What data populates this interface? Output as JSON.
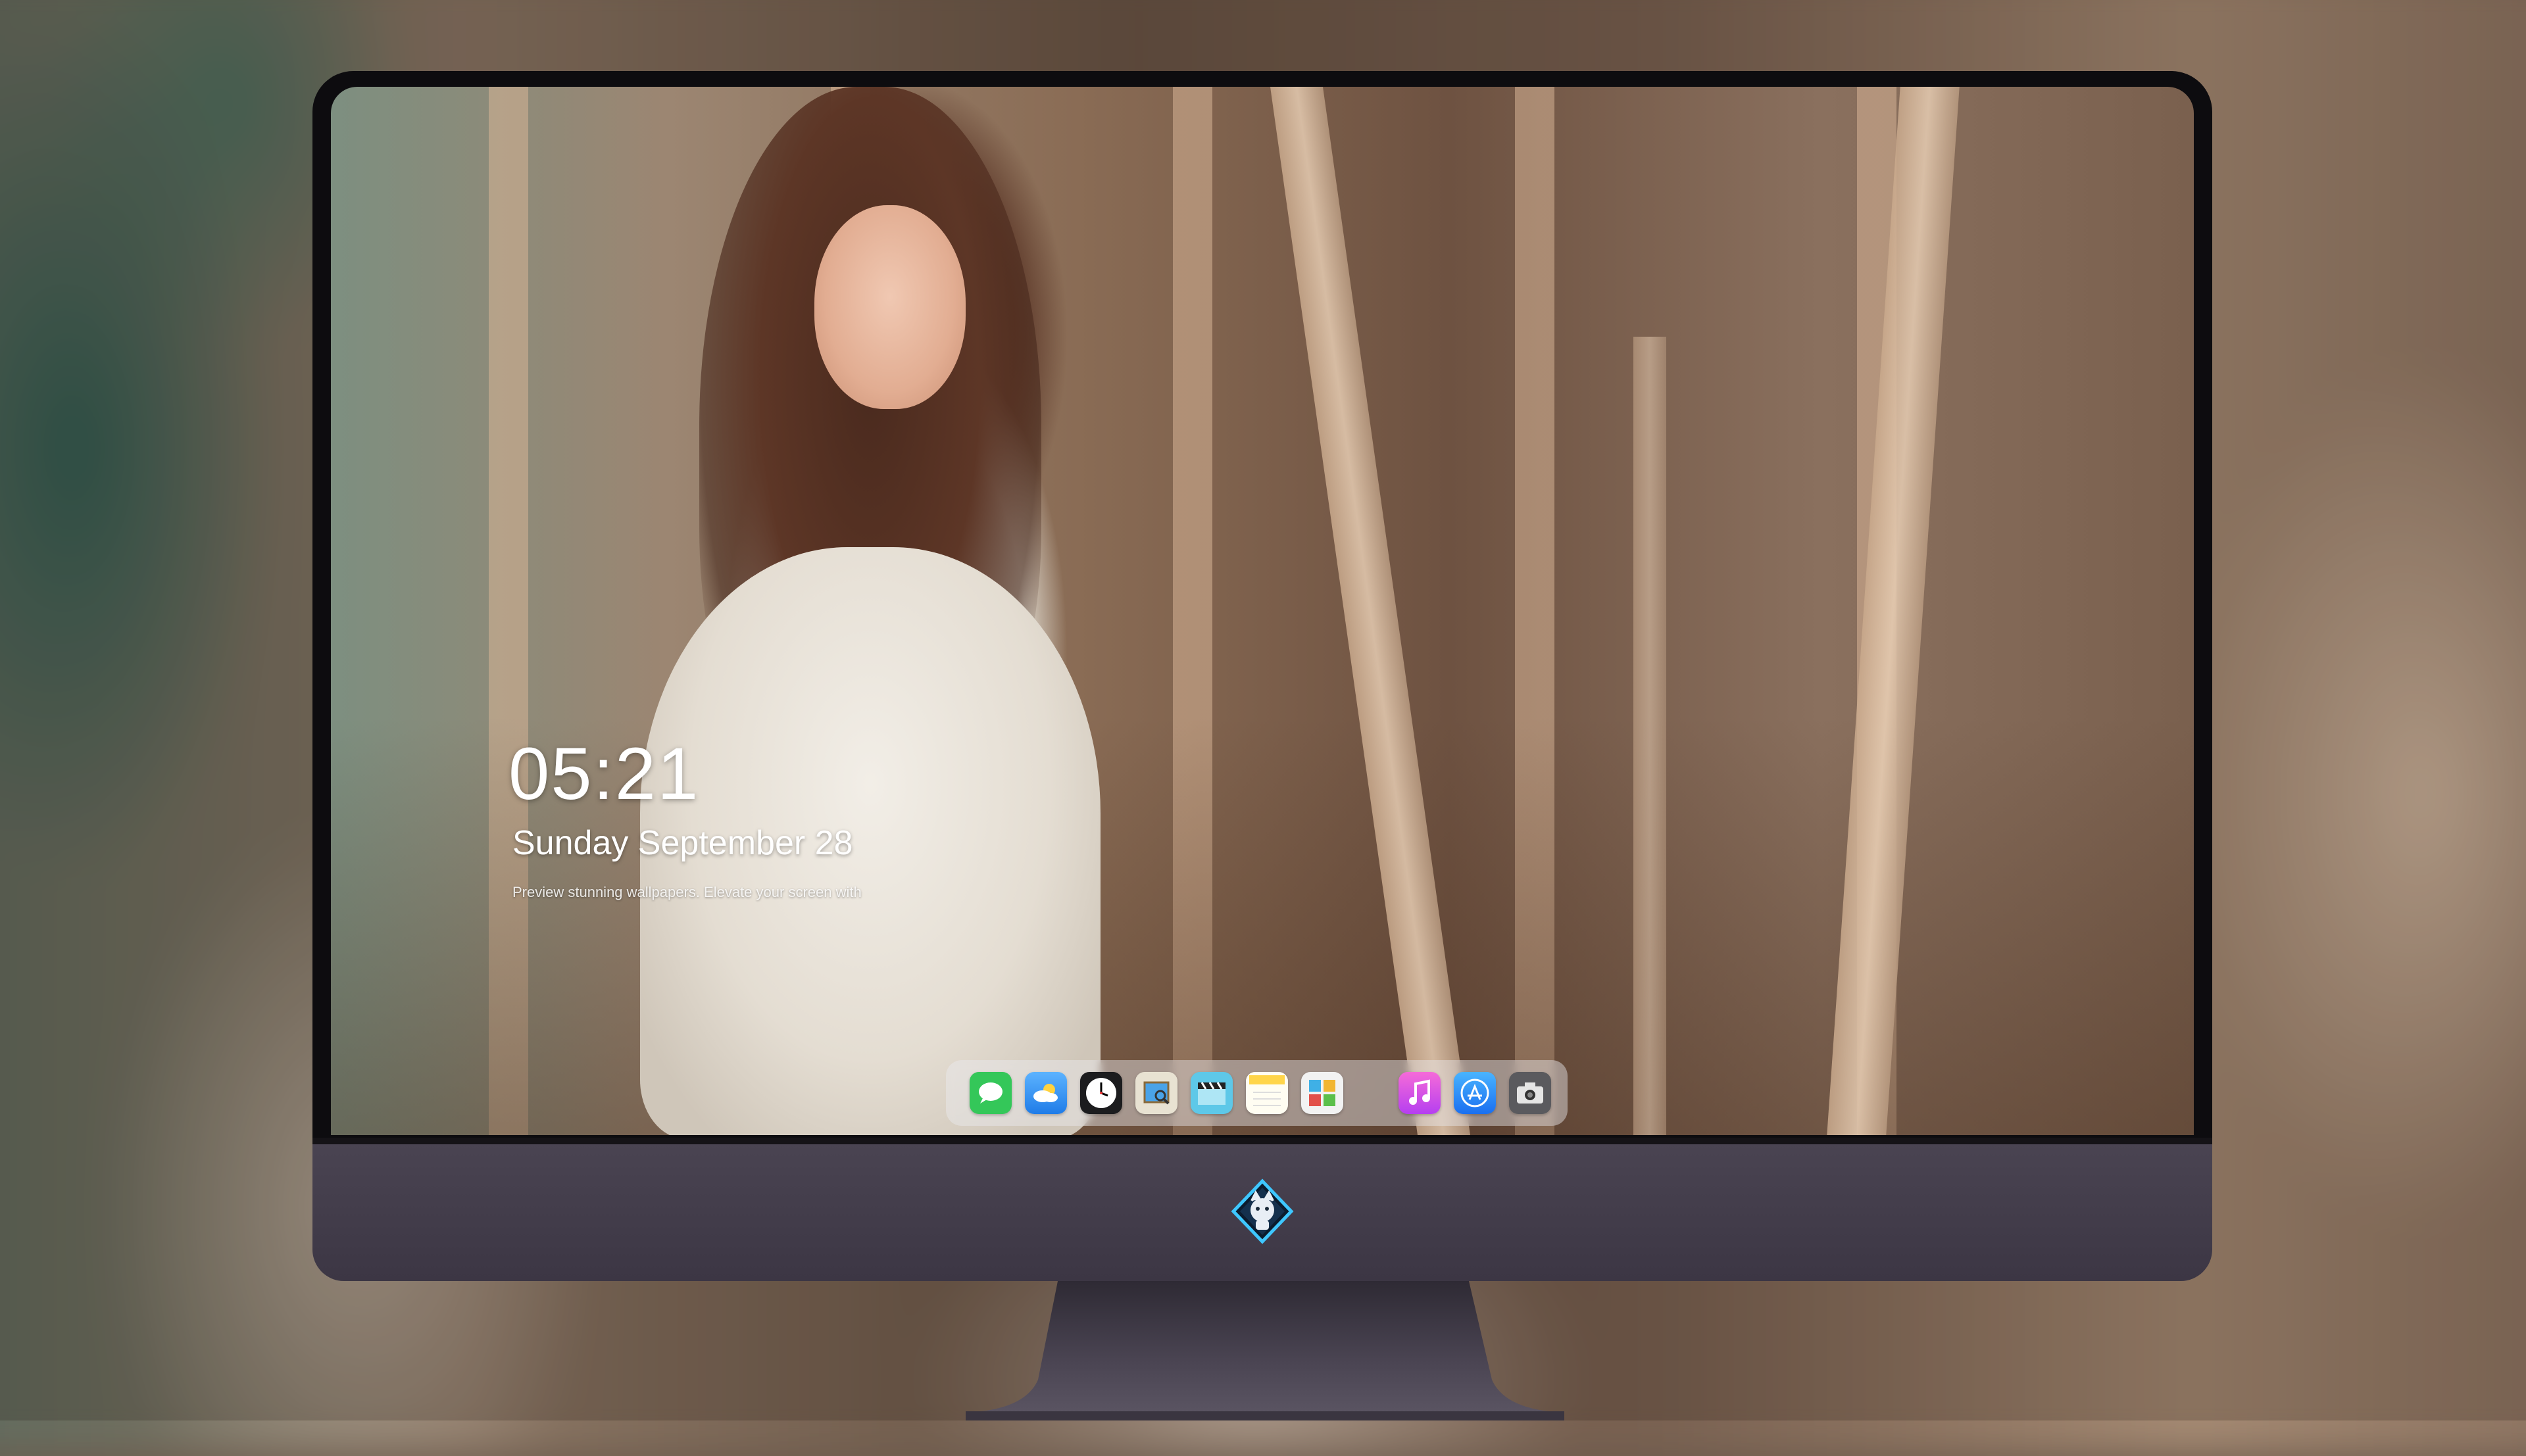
{
  "lock_screen": {
    "time": "05:21",
    "date": "Sunday September 28",
    "tagline": "Preview stunning wallpapers. Elevate your screen with"
  },
  "dock": {
    "apps": [
      {
        "name": "messages",
        "icon": "messages-icon",
        "color": "#34c759"
      },
      {
        "name": "weather",
        "icon": "weather-icon",
        "color": "#2f8cf0"
      },
      {
        "name": "clock",
        "icon": "clock-icon",
        "color": "#1c1c1e"
      },
      {
        "name": "preview",
        "icon": "preview-icon",
        "color": "#e8e2d2"
      },
      {
        "name": "clips",
        "icon": "clapperboard-icon",
        "color": "#5ec8e8"
      },
      {
        "name": "notes",
        "icon": "notes-icon",
        "color": "#ffd54a"
      },
      {
        "name": "photo-booth",
        "icon": "photo-grid-icon",
        "color": "#f2f2f2"
      },
      {
        "name": "itunes",
        "icon": "music-note-icon",
        "color": "#e24bd1"
      },
      {
        "name": "app-store",
        "icon": "app-store-icon",
        "color": "#1e8cf5"
      },
      {
        "name": "screenshot",
        "icon": "camera-icon",
        "color": "#5a5a5e"
      }
    ]
  },
  "monitor": {
    "logo_icon": "mascot-logo-icon"
  }
}
